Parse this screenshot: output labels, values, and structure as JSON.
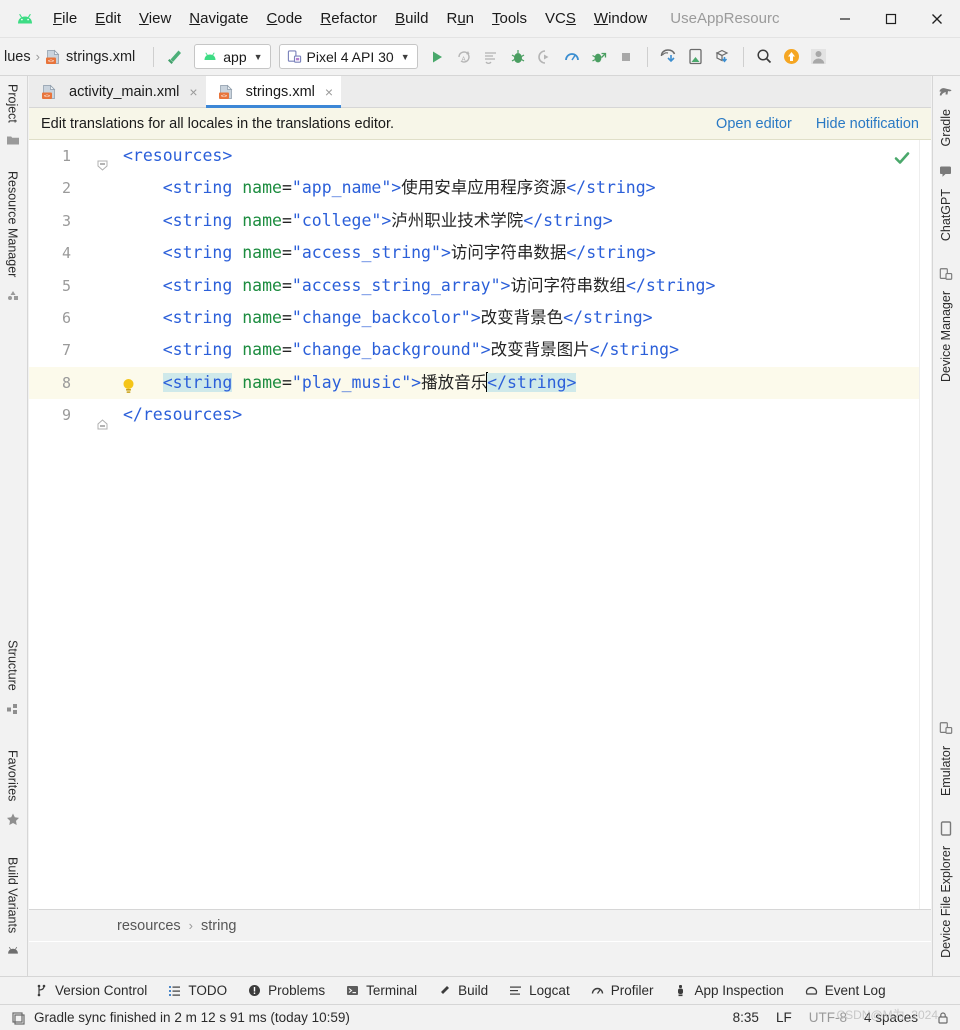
{
  "window": {
    "title": "UseAppResourc",
    "minimize_label": "minimize",
    "maximize_label": "maximize",
    "close_label": "close"
  },
  "menubar": {
    "logo_name": "android-logo",
    "items": [
      {
        "pre": "",
        "mn": "F",
        "post": "ile"
      },
      {
        "pre": "",
        "mn": "E",
        "post": "dit"
      },
      {
        "pre": "",
        "mn": "V",
        "post": "iew"
      },
      {
        "pre": "",
        "mn": "N",
        "post": "avigate"
      },
      {
        "pre": "",
        "mn": "C",
        "post": "ode"
      },
      {
        "pre": "",
        "mn": "R",
        "post": "efactor"
      },
      {
        "pre": "",
        "mn": "B",
        "post": "uild"
      },
      {
        "pre": "R",
        "mn": "u",
        "post": "n"
      },
      {
        "pre": "",
        "mn": "T",
        "post": "ools"
      },
      {
        "pre": "VC",
        "mn": "S",
        "post": ""
      },
      {
        "pre": "",
        "mn": "W",
        "post": "indow"
      }
    ]
  },
  "toolbar": {
    "breadcrumb_tail": "lues",
    "breadcrumb_sep": "›",
    "breadcrumb_file": "strings.xml",
    "build_icon": "hammer-icon",
    "module_combo": "app",
    "device_combo": "Pixel 4 API 30",
    "caret": "▼",
    "icons": [
      "run-icon",
      "apply-changes-icon",
      "apply-code-changes-icon",
      "debug-icon",
      "attach-debugger-icon",
      "profiler-icon",
      "run-with-coverage-icon",
      "stop-icon",
      "sdk-manager-icon",
      "device-manager-icon",
      "avd-download-icon",
      "search-everywhere-icon",
      "update-icon",
      "account-icon"
    ]
  },
  "tabs": [
    {
      "label": "activity_main.xml",
      "active": false,
      "close": "×",
      "icon": "xml-file-icon"
    },
    {
      "label": "strings.xml",
      "active": true,
      "close": "×",
      "icon": "xml-file-icon"
    }
  ],
  "notification": {
    "message": "Edit translations for all locales in the translations editor.",
    "open_editor": "Open editor",
    "hide_notification": "Hide notification"
  },
  "editor": {
    "inspection_status": "no-errors-check-icon",
    "intention_bulb": "intention-bulb-icon",
    "lines": [
      {
        "n": "1",
        "indent": 0,
        "fold": "minus-expanded",
        "tokens": [
          {
            "t": "tag",
            "s": "<resources>"
          }
        ]
      },
      {
        "n": "2",
        "indent": 1,
        "tokens": [
          {
            "t": "tag",
            "s": "<string"
          },
          {
            "t": "plain",
            "s": " "
          },
          {
            "t": "attr",
            "s": "name"
          },
          {
            "t": "plain",
            "s": "="
          },
          {
            "t": "val",
            "s": "\"app_name\""
          },
          {
            "t": "tag",
            "s": ">"
          },
          {
            "t": "txt",
            "s": "使用安卓应用程序资源"
          },
          {
            "t": "tag",
            "s": "</string>"
          }
        ]
      },
      {
        "n": "3",
        "indent": 1,
        "tokens": [
          {
            "t": "tag",
            "s": "<string"
          },
          {
            "t": "plain",
            "s": " "
          },
          {
            "t": "attr",
            "s": "name"
          },
          {
            "t": "plain",
            "s": "="
          },
          {
            "t": "val",
            "s": "\"college\""
          },
          {
            "t": "tag",
            "s": ">"
          },
          {
            "t": "txt",
            "s": "泸州职业技术学院"
          },
          {
            "t": "tag",
            "s": "</string>"
          }
        ]
      },
      {
        "n": "4",
        "indent": 1,
        "tokens": [
          {
            "t": "tag",
            "s": "<string"
          },
          {
            "t": "plain",
            "s": " "
          },
          {
            "t": "attr",
            "s": "name"
          },
          {
            "t": "plain",
            "s": "="
          },
          {
            "t": "val",
            "s": "\"access_string\""
          },
          {
            "t": "tag",
            "s": ">"
          },
          {
            "t": "txt",
            "s": "访问字符串数据"
          },
          {
            "t": "tag",
            "s": "</string>"
          }
        ]
      },
      {
        "n": "5",
        "indent": 1,
        "tokens": [
          {
            "t": "tag",
            "s": "<string"
          },
          {
            "t": "plain",
            "s": " "
          },
          {
            "t": "attr",
            "s": "name"
          },
          {
            "t": "plain",
            "s": "="
          },
          {
            "t": "val",
            "s": "\"access_string_array\""
          },
          {
            "t": "tag",
            "s": ">"
          },
          {
            "t": "txt",
            "s": "访问字符串数组"
          },
          {
            "t": "tag",
            "s": "</string>"
          }
        ]
      },
      {
        "n": "6",
        "indent": 1,
        "tokens": [
          {
            "t": "tag",
            "s": "<string"
          },
          {
            "t": "plain",
            "s": " "
          },
          {
            "t": "attr",
            "s": "name"
          },
          {
            "t": "plain",
            "s": "="
          },
          {
            "t": "val",
            "s": "\"change_backcolor\""
          },
          {
            "t": "tag",
            "s": ">"
          },
          {
            "t": "txt",
            "s": "改变背景色"
          },
          {
            "t": "tag",
            "s": "</string>"
          }
        ]
      },
      {
        "n": "7",
        "indent": 1,
        "tokens": [
          {
            "t": "tag",
            "s": "<string"
          },
          {
            "t": "plain",
            "s": " "
          },
          {
            "t": "attr",
            "s": "name"
          },
          {
            "t": "plain",
            "s": "="
          },
          {
            "t": "val",
            "s": "\"change_background\""
          },
          {
            "t": "tag",
            "s": ">"
          },
          {
            "t": "txt",
            "s": "改变背景图片"
          },
          {
            "t": "tag",
            "s": "</string>"
          }
        ]
      },
      {
        "n": "8",
        "indent": 1,
        "current": true,
        "bulb": true,
        "tokens": [
          {
            "t": "tag",
            "sel": true,
            "s": "<string"
          },
          {
            "t": "plain",
            "s": " "
          },
          {
            "t": "attr",
            "s": "name"
          },
          {
            "t": "plain",
            "s": "="
          },
          {
            "t": "val",
            "s": "\"play_music\""
          },
          {
            "t": "tag",
            "s": ">"
          },
          {
            "t": "txt",
            "s": "播放音乐"
          },
          {
            "t": "caret",
            "s": ""
          },
          {
            "t": "tag",
            "sel": true,
            "s": "</string>"
          }
        ]
      },
      {
        "n": "9",
        "indent": 0,
        "fold": "minus-collapsed",
        "tokens": [
          {
            "t": "tag",
            "s": "</resources>"
          }
        ]
      }
    ],
    "breadcrumb": [
      "resources",
      "string"
    ],
    "breadcrumb_sep": "›"
  },
  "left_stripe": {
    "top": [
      {
        "label": "Project",
        "icon": "project-folder-icon"
      },
      {
        "label": "Resource Manager",
        "icon": "resource-manager-icon"
      }
    ],
    "bottom": [
      {
        "label": "Structure",
        "icon": "structure-icon"
      },
      {
        "label": "Favorites",
        "icon": "star-icon"
      },
      {
        "label": "Build Variants",
        "icon": "android-icon"
      }
    ]
  },
  "right_stripe": {
    "top": [
      {
        "label": "Gradle",
        "icon": "gradle-elephant-icon"
      },
      {
        "label": "ChatGPT",
        "icon": "chat-bubble-icon"
      },
      {
        "label": "Device Manager",
        "icon": "device-manager-icon"
      }
    ],
    "bottom": [
      {
        "label": "Emulator",
        "icon": "emulator-icon"
      },
      {
        "label": "Device File Explorer",
        "icon": "phone-icon"
      }
    ]
  },
  "tool_window_bar": [
    {
      "label": "Version Control",
      "icon": "branch-icon"
    },
    {
      "label": "TODO",
      "icon": "todo-list-icon"
    },
    {
      "label": "Problems",
      "icon": "problems-icon"
    },
    {
      "label": "Terminal",
      "icon": "terminal-icon"
    },
    {
      "label": "Build",
      "icon": "hammer-icon"
    },
    {
      "label": "Logcat",
      "icon": "logcat-icon"
    },
    {
      "label": "Profiler",
      "icon": "profiler-icon"
    },
    {
      "label": "App Inspection",
      "icon": "app-inspection-icon"
    },
    {
      "label": "Event Log",
      "icon": "event-log-icon"
    }
  ],
  "status_bar": {
    "message": "Gradle sync finished in 2 m 12 s 91 ms (today 10:59)",
    "message_icon": "notification-icon",
    "caret_position": "8:35",
    "line_separator": "LF",
    "encoding": "UTF-8",
    "indent": "4 spaces",
    "watermark": "CSDN@M为_2024",
    "lock_icon": "read-only-icon"
  },
  "colors": {
    "accent_blue": "#2b5fd9",
    "attr_green": "#1c8c3f",
    "link_blue": "#2979c4",
    "tab_underline": "#3d87d6",
    "current_line": "#fcfaeb",
    "selection": "#cfe9ea",
    "android_green": "#3ddc84",
    "warning_yellow": "#f5c518"
  }
}
